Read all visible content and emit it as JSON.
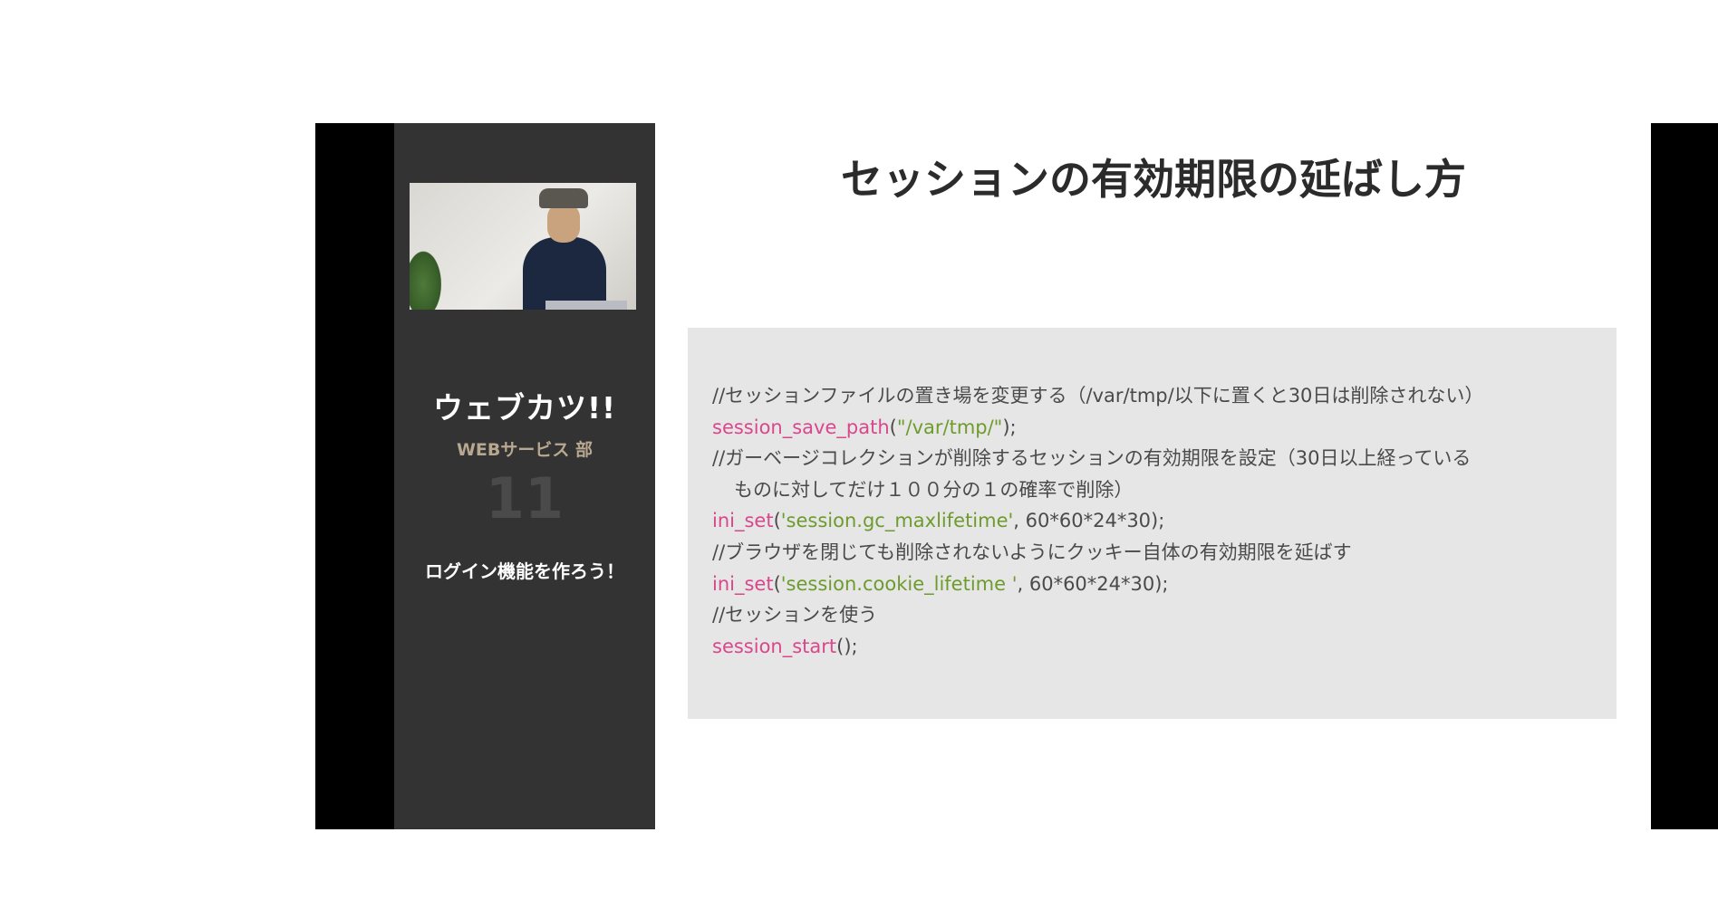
{
  "sidebar": {
    "logo_text": "ウェブカツ!!",
    "subtitle": "WEBサービス 部",
    "episode_number": "11",
    "episode_title": "ログイン機能を作ろう！"
  },
  "slide": {
    "title": "セッションの有効期限の延ばし方"
  },
  "code": {
    "line1": "//セッションファイルの置き場を変更する（/var/tmp/以下に置くと30日は削除されない）",
    "line2_fn": "session_save_path",
    "line2_open": "(",
    "line2_str": "\"/var/tmp/\"",
    "line2_close": ");",
    "line3": "//ガーベージコレクションが削除するセッションの有効期限を設定（30日以上経っている",
    "line4": "ものに対してだけ１００分の１の確率で削除）",
    "line5_fn": "ini_set",
    "line5_open": "(",
    "line5_str": "'session.gc_maxlifetime'",
    "line5_rest": ", 60*60*24*30);",
    "line6": "//ブラウザを閉じても削除されないようにクッキー自体の有効期限を延ばす",
    "line7_fn": "ini_set",
    "line7_open": "(",
    "line7_str": "'session.cookie_lifetime '",
    "line7_rest": ", 60*60*24*30);",
    "line8": "//セッションを使う",
    "line9_fn": "session_start",
    "line9_rest": "();"
  },
  "colors": {
    "function": "#d9478c",
    "string": "#6e9b2e",
    "sidebar_bg": "#333333",
    "code_bg": "#e6e6e6"
  }
}
